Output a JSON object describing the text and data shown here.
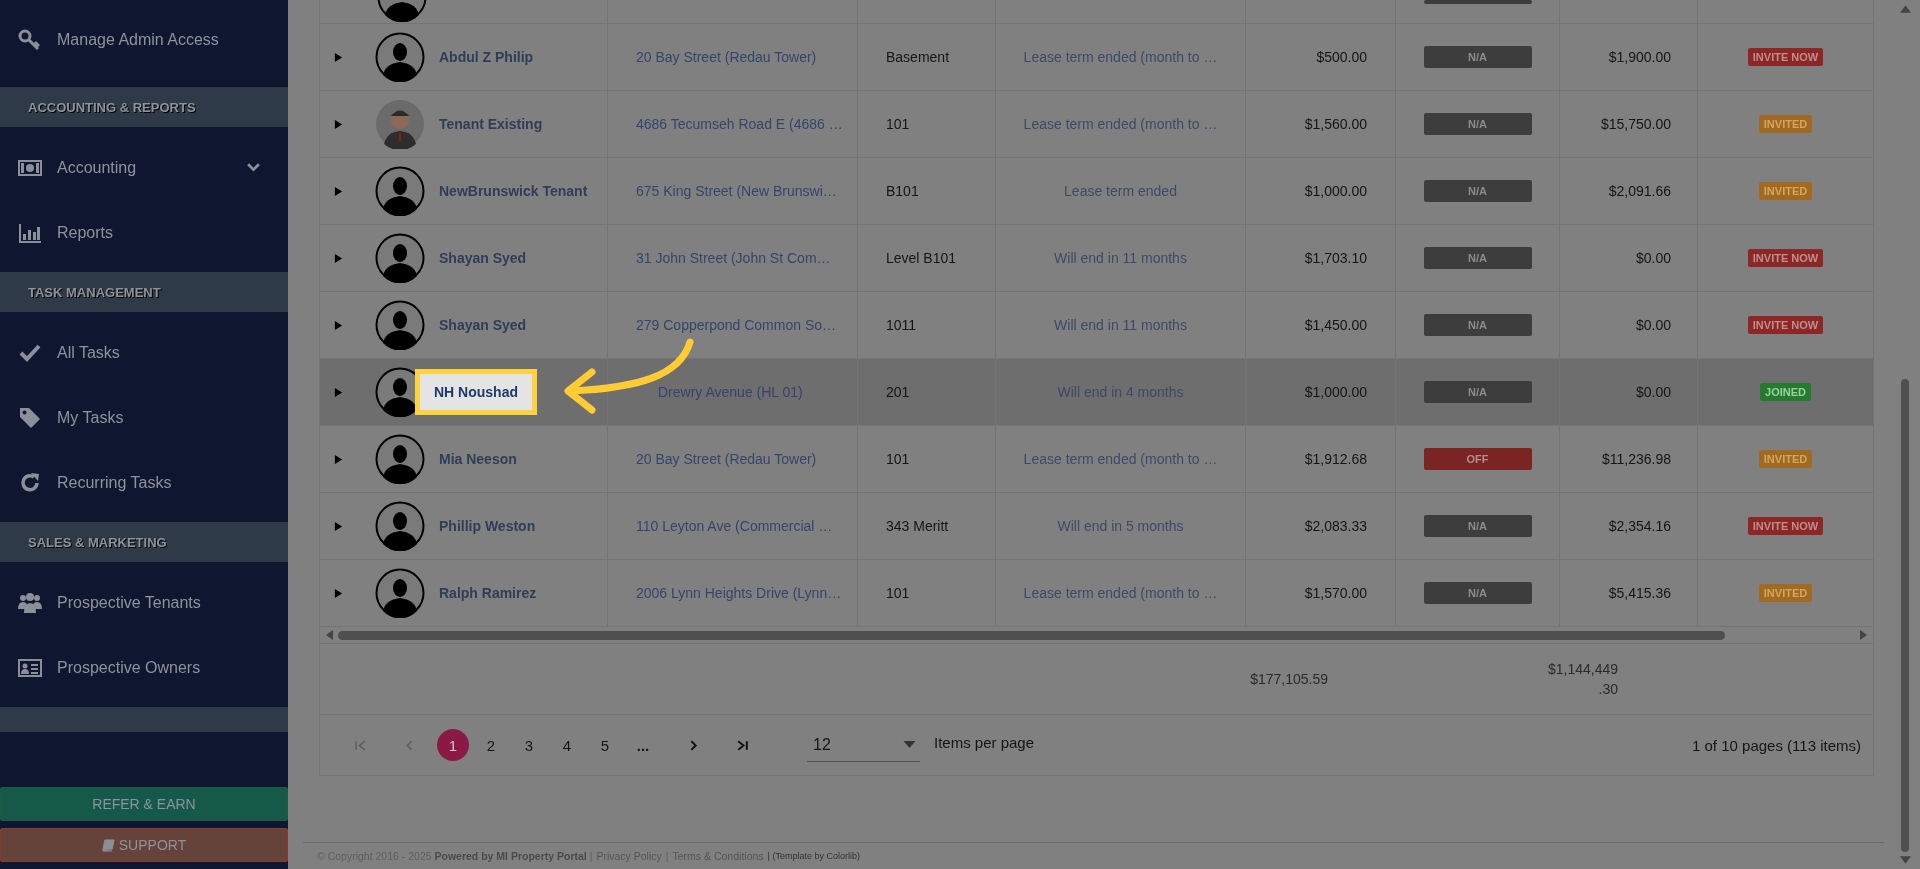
{
  "sidebar": {
    "items": [
      {
        "kind": "item",
        "label": "Manage Admin Access",
        "has_submenu": false
      },
      {
        "kind": "section",
        "label": "ACCOUNTING & REPORTS"
      },
      {
        "kind": "item",
        "label": "Accounting",
        "has_submenu": true
      },
      {
        "kind": "item",
        "label": "Reports",
        "has_submenu": false
      },
      {
        "kind": "section",
        "label": "TASK MANAGEMENT"
      },
      {
        "kind": "item",
        "label": "All Tasks",
        "has_submenu": false
      },
      {
        "kind": "item",
        "label": "My Tasks",
        "has_submenu": false
      },
      {
        "kind": "item",
        "label": "Recurring Tasks",
        "has_submenu": false
      },
      {
        "kind": "section",
        "label": "SALES & MARKETING"
      },
      {
        "kind": "item",
        "label": "Prospective Tenants",
        "has_submenu": false
      },
      {
        "kind": "item",
        "label": "Prospective Owners",
        "has_submenu": false
      },
      {
        "kind": "blank"
      }
    ],
    "buttons": [
      {
        "kind": "refer",
        "label": "REFER & EARN"
      },
      {
        "kind": "support",
        "label": "SUPPORT"
      }
    ]
  },
  "table": {
    "rows": [
      {
        "avatar": {
          "kind": "default"
        },
        "name": "Abdul Z Philip",
        "address": "20 Bay Street (Redau Tower)",
        "unit": "Basement",
        "lease": "Lease term ended (month to …",
        "rent": "$500.00",
        "autopay": {
          "kind": "na",
          "text": "N/A"
        },
        "balance": "$1,900.00",
        "invite": {
          "kind": "invite",
          "text": "INVITE NOW"
        },
        "selected": false,
        "spotlight": false
      },
      {
        "avatar": {
          "kind": "photo"
        },
        "name": "Tenant Existing",
        "address": "4686 Tecumseh Road E (4686 …",
        "unit": "101",
        "lease": "Lease term ended (month to …",
        "rent": "$1,560.00",
        "autopay": {
          "kind": "na",
          "text": "N/A"
        },
        "balance": "$15,750.00",
        "invite": {
          "kind": "invited",
          "text": "INVITED"
        },
        "selected": false,
        "spotlight": false
      },
      {
        "avatar": {
          "kind": "default"
        },
        "name": "NewBrunswick Tenant",
        "address": "675 King Street (New Brunswi…",
        "unit": "B101",
        "lease": "Lease term ended",
        "rent": "$1,000.00",
        "autopay": {
          "kind": "na",
          "text": "N/A"
        },
        "balance": "$2,091.66",
        "invite": {
          "kind": "invited",
          "text": "INVITED"
        },
        "selected": false,
        "spotlight": false
      },
      {
        "avatar": {
          "kind": "default"
        },
        "name": "Shayan Syed",
        "address": "31 John Street (John St Com…",
        "unit": "Level B101",
        "lease": "Will end in 11 months",
        "rent": "$1,703.10",
        "autopay": {
          "kind": "na",
          "text": "N/A"
        },
        "balance": "$0.00",
        "invite": {
          "kind": "invite",
          "text": "INVITE NOW"
        },
        "selected": false,
        "spotlight": false
      },
      {
        "avatar": {
          "kind": "default"
        },
        "name": "Shayan Syed",
        "address": "279 Copperpond Common So…",
        "unit": "1011",
        "lease": "Will end in 11 months",
        "rent": "$1,450.00",
        "autopay": {
          "kind": "na",
          "text": "N/A"
        },
        "balance": "$0.00",
        "invite": {
          "kind": "invite",
          "text": "INVITE NOW"
        },
        "selected": false,
        "spotlight": false
      },
      {
        "avatar": {
          "kind": "default"
        },
        "name": "NH Noushad",
        "address": "Drewry Avenue (HL 01)",
        "unit": "201",
        "lease": "Will end in 4 months",
        "rent": "$1,000.00",
        "autopay": {
          "kind": "na",
          "text": "N/A"
        },
        "balance": "$0.00",
        "invite": {
          "kind": "joined",
          "text": "JOINED"
        },
        "selected": true,
        "spotlight": true
      },
      {
        "avatar": {
          "kind": "default"
        },
        "name": "Mia Neeson",
        "address": "20 Bay Street (Redau Tower)",
        "unit": "101",
        "lease": "Lease term ended (month to …",
        "rent": "$1,912.68",
        "autopay": {
          "kind": "off",
          "text": "OFF"
        },
        "balance": "$11,236.98",
        "invite": {
          "kind": "invited",
          "text": "INVITED"
        },
        "selected": false,
        "spotlight": false
      },
      {
        "avatar": {
          "kind": "default"
        },
        "name": "Phillip Weston",
        "address": "110 Leyton Ave (Commercial …",
        "unit": "343 Meritt",
        "lease": "Will end in 5 months",
        "rent": "$2,083.33",
        "autopay": {
          "kind": "na",
          "text": "N/A"
        },
        "balance": "$2,354.16",
        "invite": {
          "kind": "invite",
          "text": "INVITE NOW"
        },
        "selected": false,
        "spotlight": false
      },
      {
        "avatar": {
          "kind": "default"
        },
        "name": "Ralph Ramirez",
        "address": "2006 Lynn Heights Drive (Lynn…",
        "unit": "101",
        "lease": "Lease term ended (month to …",
        "rent": "$1,570.00",
        "autopay": {
          "kind": "na",
          "text": "N/A"
        },
        "balance": "$5,415.36",
        "invite": {
          "kind": "invited",
          "text": "INVITED"
        },
        "selected": false,
        "spotlight": false
      }
    ],
    "totals": {
      "rent": "$177,105.59",
      "balance": "$1,144,449.30"
    }
  },
  "pagination": {
    "pages": [
      {
        "label": "1",
        "selected": true
      },
      {
        "label": "2",
        "selected": false
      },
      {
        "label": "3",
        "selected": false
      },
      {
        "label": "4",
        "selected": false
      },
      {
        "label": "5",
        "selected": false
      }
    ],
    "more": "...",
    "page_size": "12",
    "page_size_label": "Items per page",
    "summary": "1 of 10 pages (113 items)"
  },
  "footer": [
    {
      "kind": "text",
      "text": "© Copyright 2016 - 2025 **Powered by MI Property Portal** |"
    },
    {
      "kind": "link",
      "text": "Privacy Policy"
    },
    {
      "kind": "text",
      "text": "|"
    },
    {
      "kind": "link",
      "text": "Terms & Conditions"
    },
    {
      "kind": "small",
      "text": "| (Template by Colorlib)"
    }
  ]
}
